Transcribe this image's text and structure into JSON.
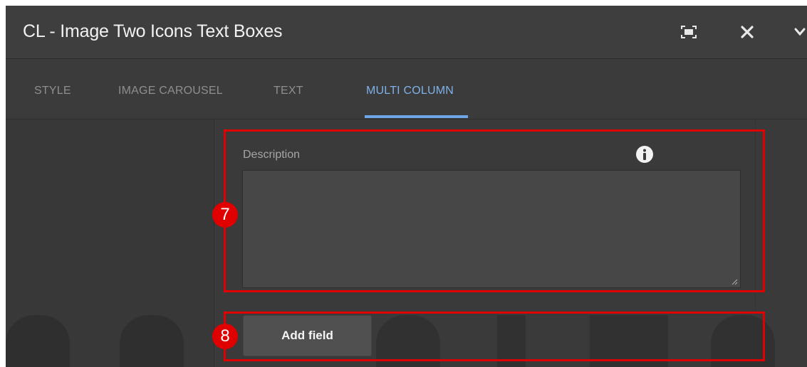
{
  "dialog": {
    "title": "CL - Image Two Icons Text Boxes",
    "controls": {
      "fullscreen_icon": "fullscreen-icon",
      "close_icon": "close-icon",
      "collapse_icon": "chevron-down-icon"
    }
  },
  "tabs": [
    {
      "label": "STYLE",
      "active": false
    },
    {
      "label": "IMAGE CAROUSEL",
      "active": false
    },
    {
      "label": "TEXT",
      "active": false
    },
    {
      "label": "MULTI COLUMN",
      "active": true
    }
  ],
  "form": {
    "description_label": "Description",
    "description_value": "",
    "info_icon": "info-icon",
    "add_field_label": "Add field"
  },
  "annotations": [
    {
      "number": "7",
      "color": "#e00000"
    },
    {
      "number": "8",
      "color": "#e00000"
    }
  ],
  "colors": {
    "accent": "#7fb1ea",
    "annotation": "#e00000"
  }
}
